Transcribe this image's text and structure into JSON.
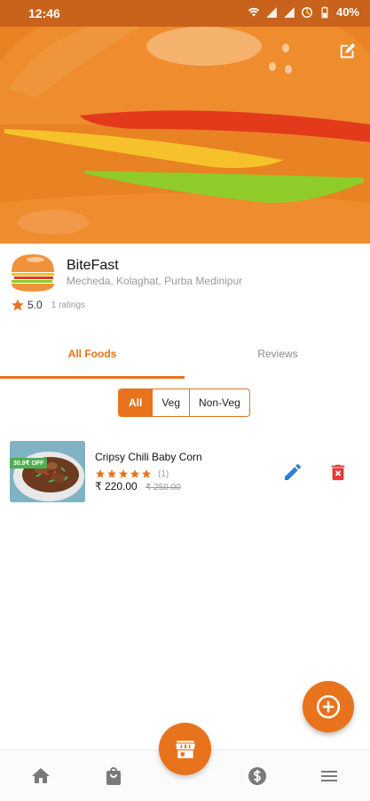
{
  "status_bar": {
    "time": "12:46",
    "battery": "40%",
    "icons": [
      "wifi-icon",
      "signal-icon",
      "signal-icon",
      "data-saver-icon",
      "battery-icon"
    ]
  },
  "banner": {
    "edit_icon": "edit-square-icon"
  },
  "restaurant": {
    "name": "BiteFast",
    "address": "Mecheda, Kolaghat, Purba Medinipur",
    "rating": "5.0",
    "rating_count": "1 ratings"
  },
  "tabs": [
    {
      "label": "All Foods",
      "active": true
    },
    {
      "label": "Reviews",
      "active": false
    }
  ],
  "filter": {
    "options": [
      "All",
      "Veg",
      "Non-Veg"
    ],
    "selected": "All"
  },
  "foods": [
    {
      "name": "Cripsy Chili Baby Corn",
      "discount": "30.9₹ OFF",
      "stars": 5,
      "review_count": "(1)",
      "price": "₹ 220.00",
      "old_price": "₹ 250.00"
    }
  ],
  "bottom_nav": [
    "home-icon",
    "bag-icon",
    "store-icon",
    "dollar-icon",
    "menu-icon"
  ],
  "colors": {
    "accent": "#e8731c",
    "status_bar": "#c9621a",
    "edit": "#2f7fd4",
    "delete": "#e53935",
    "discount": "#4caf50"
  }
}
